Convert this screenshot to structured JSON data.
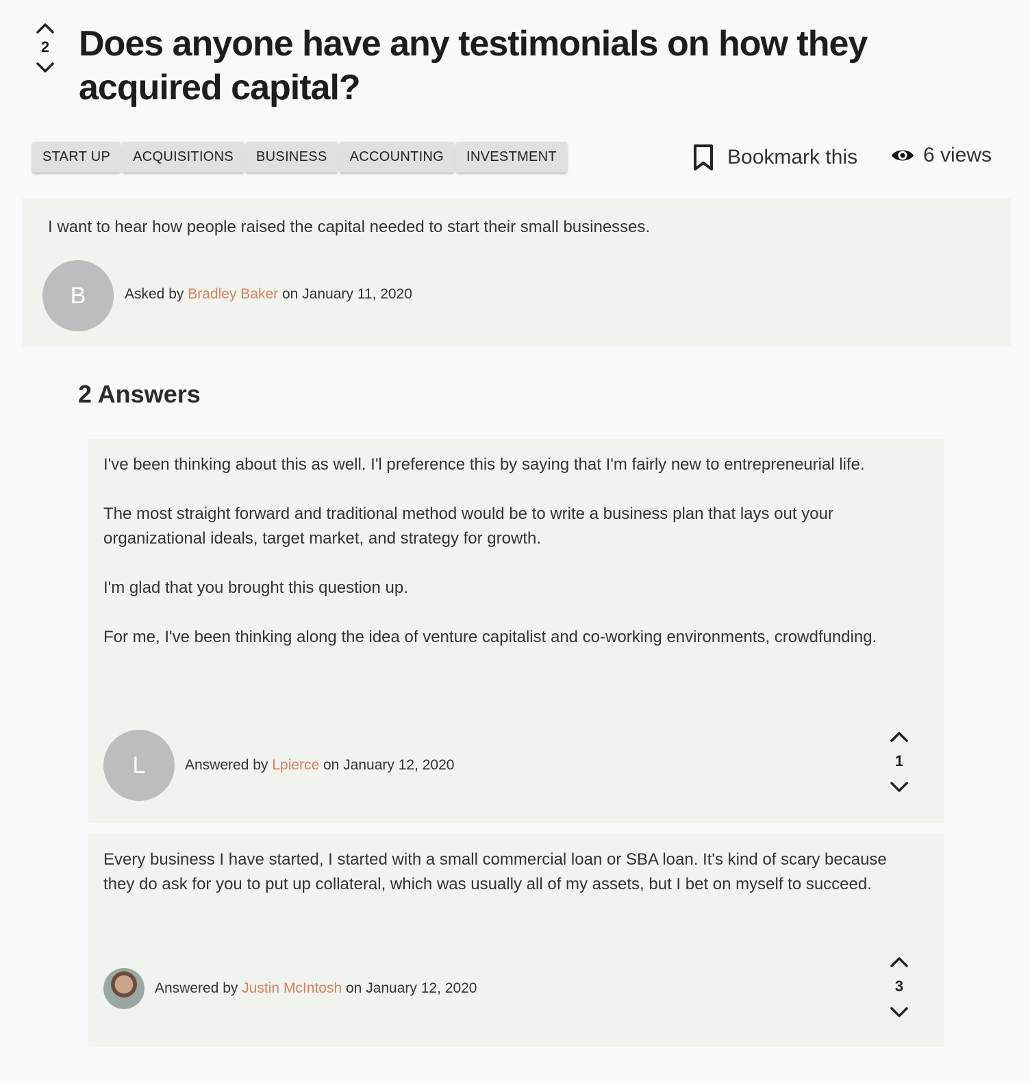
{
  "question": {
    "title": "Does anyone have any testimonials on how they acquired capital?",
    "votes": "2",
    "tags": [
      "START UP",
      "ACQUISITIONS",
      "BUSINESS",
      "ACCOUNTING",
      "INVESTMENT"
    ],
    "bookmark_label": "Bookmark this",
    "views_label": "6 views",
    "body": "I want to hear how people raised the capital needed to start their small businesses.",
    "avatar_letter": "B",
    "asked_prefix": "Asked by",
    "author": "Bradley Baker",
    "date_text": "on January 11, 2020"
  },
  "answers_heading": "2 Answers",
  "answers": [
    {
      "paragraphs": [
        "I've been thinking about this as well. I'l preference this by saying that I'm fairly new to entrepreneurial life.",
        "The most straight forward and traditional method would be to write a business plan that lays out your organizational ideals, target market, and strategy for growth.",
        "I'm glad that you brought this question up.",
        "For me, I've been thinking along the idea of venture capitalist and co-working environments, crowdfunding."
      ],
      "avatar_letter": "L",
      "answered_prefix": "Answered by",
      "author": "Lpierce",
      "date_text": "on January 12, 2020",
      "votes": "1"
    },
    {
      "paragraphs": [
        "Every business I have started, I started with a small commercial loan or SBA loan. It's kind of scary because they do ask for you to put up collateral, which was usually all of my assets, but I bet on myself to succeed."
      ],
      "answered_prefix": "Answered by",
      "author": "Justin McIntosh",
      "date_text": "on January 12, 2020",
      "votes": "3"
    }
  ],
  "colors": {
    "link": "#d9805f",
    "card_bg": "#f1f3ee",
    "tag_bg": "#e0e0e0",
    "avatar_bg": "#bdbdbd"
  },
  "icons": [
    "chevron-up-icon",
    "chevron-down-icon",
    "bookmark-icon",
    "eye-icon"
  ]
}
